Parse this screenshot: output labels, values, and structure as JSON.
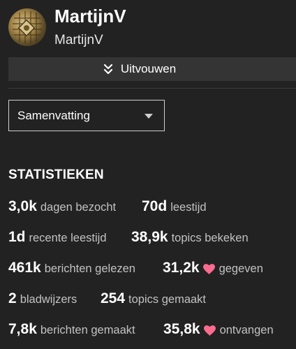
{
  "profile": {
    "display_name": "MartijnV",
    "username": "MartijnV"
  },
  "expand_button": {
    "label": "Uitvouwen",
    "icon": "double-chevron-down-icon"
  },
  "summary_select": {
    "selected": "Samenvatting"
  },
  "stats": {
    "title": "STATISTIEKEN",
    "items": [
      {
        "value": "3,0k",
        "label": "dagen bezocht"
      },
      {
        "value": "70d",
        "label": "leestijd"
      },
      {
        "value": "1d",
        "label": "recente leestijd"
      },
      {
        "value": "38,9k",
        "label": "topics bekeken"
      },
      {
        "value": "461k",
        "label": "berichten gelezen"
      },
      {
        "value": "31,2k",
        "label": "gegeven",
        "icon": "heart-icon"
      },
      {
        "value": "2",
        "label": "bladwijzers"
      },
      {
        "value": "254",
        "label": "topics gemaakt"
      },
      {
        "value": "7,8k",
        "label": "berichten gemaakt"
      },
      {
        "value": "35,8k",
        "label": "ontvangen",
        "icon": "heart-icon"
      }
    ]
  },
  "colors": {
    "background": "#222222",
    "bar": "#343434",
    "heart": "#fa6c8d",
    "muted_text": "#c2c2c2"
  }
}
